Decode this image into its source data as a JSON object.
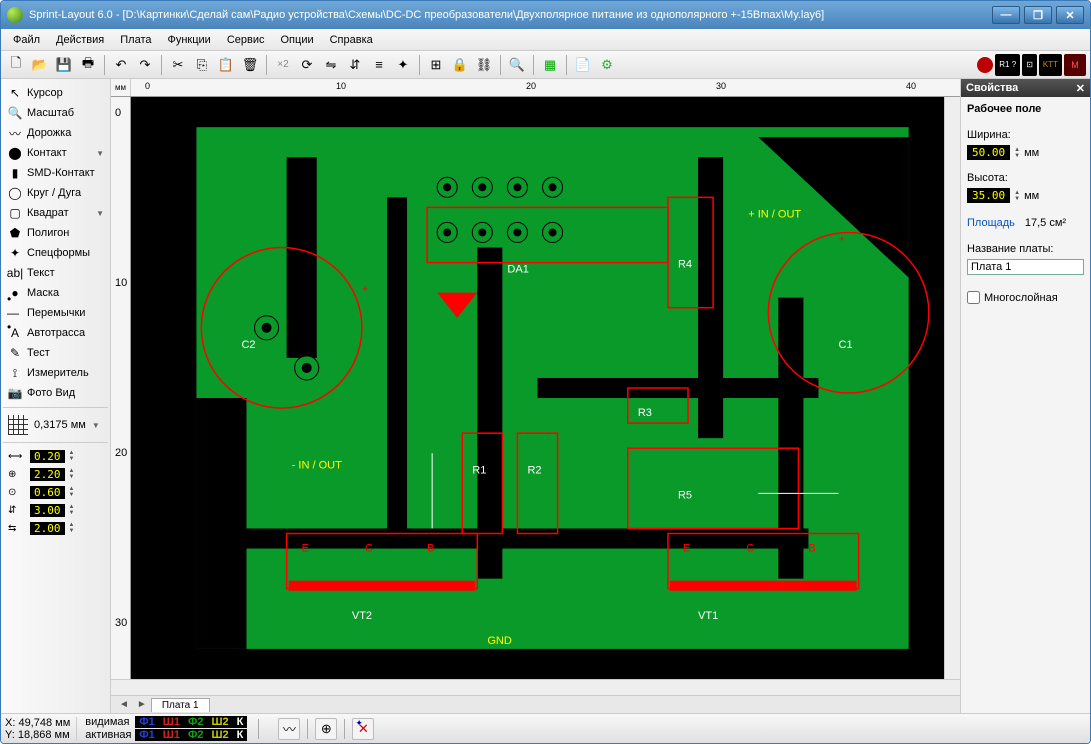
{
  "title": "Sprint-Layout 6.0 - [D:\\Картинки\\Сделай сам\\Радио устройства\\Схемы\\DC-DC преобразователи\\Двухполярное питание из однополярного +-15Bmax\\My.lay6]",
  "menu": [
    "Файл",
    "Действия",
    "Плата",
    "Функции",
    "Сервис",
    "Опции",
    "Справка"
  ],
  "tools": [
    {
      "icon": "↖",
      "label": "Курсор",
      "arrow": false
    },
    {
      "icon": "🔍",
      "label": "Масштаб",
      "arrow": false
    },
    {
      "icon": "〰",
      "label": "Дорожка",
      "arrow": false
    },
    {
      "icon": "⬤",
      "label": "Контакт",
      "arrow": true
    },
    {
      "icon": "▮",
      "label": "SMD-Контакт",
      "arrow": false
    },
    {
      "icon": "◯",
      "label": "Круг / Дуга",
      "arrow": false
    },
    {
      "icon": "▢",
      "label": "Квадрат",
      "arrow": true
    },
    {
      "icon": "⬟",
      "label": "Полигон",
      "arrow": false
    },
    {
      "icon": "✦",
      "label": "Спецформы",
      "arrow": false
    },
    {
      "icon": "ab|",
      "label": "Текст",
      "arrow": false
    },
    {
      "icon": "●",
      "label": "Маска",
      "arrow": false
    },
    {
      "icon": "•—•",
      "label": "Перемычки",
      "arrow": false
    },
    {
      "icon": "A",
      "label": "Автотрасса",
      "arrow": false
    },
    {
      "icon": "✎",
      "label": "Тест",
      "arrow": false
    },
    {
      "icon": "⟟",
      "label": "Измеритель",
      "arrow": false
    },
    {
      "icon": "📷",
      "label": "Фото Вид",
      "arrow": false
    }
  ],
  "grid_value": "0,3175 мм",
  "sizes": [
    {
      "i": "⟷",
      "v": "0.20"
    },
    {
      "i": "⊕",
      "v": "2.20"
    },
    {
      "i": "⊙",
      "v": "0.60"
    },
    {
      "i": "⇵",
      "v": "3.00"
    },
    {
      "i": "⇆",
      "v": "2.00"
    }
  ],
  "ruler_unit": "мм",
  "ruler_ticks": [
    "0",
    "10",
    "20",
    "30",
    "40"
  ],
  "ruler_v_ticks": [
    "0",
    "10",
    "20",
    "30"
  ],
  "tab_name": "Плата 1",
  "coord_x": "X:   49,748 мм",
  "coord_y": "Y:   18,868 мм",
  "layers_visible": "видимая",
  "layers_active": "активная",
  "layer_cells": [
    {
      "t": "Ф1",
      "c": "#2040e0"
    },
    {
      "t": "Ш1",
      "c": "#d02020"
    },
    {
      "t": "Ф2",
      "c": "#10a010"
    },
    {
      "t": "Ш2",
      "c": "#c8c800"
    },
    {
      "t": "К",
      "c": "#fff"
    }
  ],
  "props": {
    "title": "Свойства",
    "section": "Рабочее поле",
    "width_label": "Ширина:",
    "width_val": "50.00",
    "height_label": "Высота:",
    "height_val": "35.00",
    "unit": "мм",
    "area_label": "Площадь",
    "area_val": "17,5 см²",
    "name_label": "Название платы:",
    "name_val": "Плата 1",
    "multilayer": "Многослойная"
  },
  "pcb_labels": {
    "da1": "DA1",
    "r1": "R1",
    "r2": "R2",
    "r3": "R3",
    "r4": "R4",
    "r5": "R5",
    "c1": "C1",
    "c2": "C2",
    "vt1": "VT1",
    "vt2": "VT2",
    "gnd": "GND",
    "pin": "+ IN / OUT",
    "min": "- IN / OUT"
  }
}
